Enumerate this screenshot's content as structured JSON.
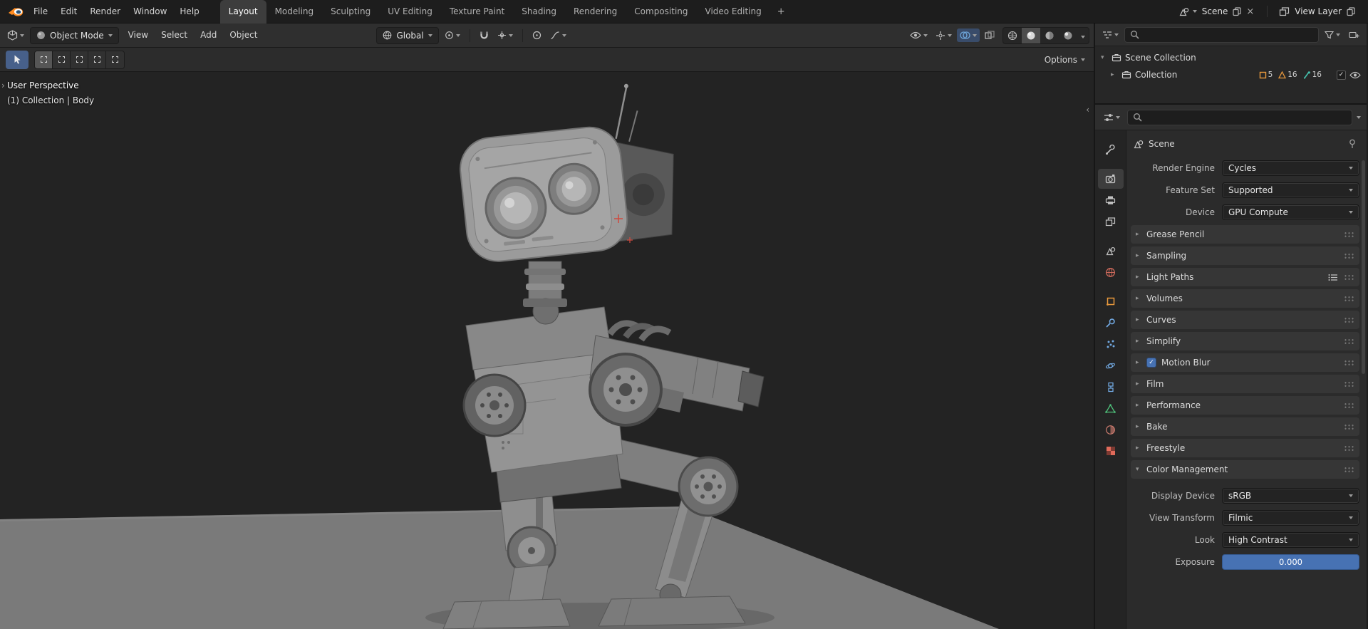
{
  "topbar": {
    "menus": [
      "File",
      "Edit",
      "Render",
      "Window",
      "Help"
    ],
    "workspaces": [
      "Layout",
      "Modeling",
      "Sculpting",
      "UV Editing",
      "Texture Paint",
      "Shading",
      "Rendering",
      "Compositing",
      "Video Editing"
    ],
    "active_workspace": "Layout",
    "new_workspace_label": "+",
    "scene_selector": {
      "label": "Scene"
    },
    "view_layer_selector": {
      "label": "View Layer"
    }
  },
  "viewport": {
    "header": {
      "mode": "Object Mode",
      "menus": [
        "View",
        "Select",
        "Add",
        "Object"
      ],
      "orientation": "Global"
    },
    "tool_settings": {
      "options_label": "Options"
    },
    "overlay": {
      "line1": "User Perspective",
      "line2": "(1) Collection | Body"
    }
  },
  "outliner": {
    "scene_collection": {
      "label": "Scene Collection"
    },
    "collection": {
      "label": "Collection",
      "badges": [
        {
          "icon": "object-icon",
          "count": "5"
        },
        {
          "icon": "mesh-icon",
          "count": "16"
        },
        {
          "icon": "armature-icon",
          "count": "16"
        }
      ]
    }
  },
  "properties": {
    "context_label": "Scene",
    "fields": [
      {
        "label": "Render Engine",
        "value": "Cycles"
      },
      {
        "label": "Feature Set",
        "value": "Supported"
      },
      {
        "label": "Device",
        "value": "GPU Compute"
      }
    ],
    "panels": [
      {
        "label": "Grease Pencil"
      },
      {
        "label": "Sampling"
      },
      {
        "label": "Light Paths",
        "has_presets": true
      },
      {
        "label": "Volumes"
      },
      {
        "label": "Curves"
      },
      {
        "label": "Simplify"
      },
      {
        "label": "Motion Blur",
        "checkbox": true,
        "checked": true
      },
      {
        "label": "Film"
      },
      {
        "label": "Performance"
      },
      {
        "label": "Bake"
      },
      {
        "label": "Freestyle"
      },
      {
        "label": "Color Management",
        "expanded": true
      }
    ],
    "color_management": {
      "fields": [
        {
          "label": "Display Device",
          "value": "sRGB"
        },
        {
          "label": "View Transform",
          "value": "Filmic"
        },
        {
          "label": "Look",
          "value": "High Contrast"
        }
      ],
      "exposure": {
        "label": "Exposure",
        "value": "0.000"
      }
    },
    "tabs": [
      "tool",
      "render",
      "output",
      "view-layer",
      "scene",
      "world",
      "object",
      "modifiers",
      "particles",
      "physics",
      "constraints",
      "object-data",
      "material",
      "texture"
    ],
    "active_tab": "render"
  },
  "colors": {
    "accent_blue": "#4772b3",
    "accent_orange": "#e8983c",
    "viewport_bg": "#232323",
    "floor": "#7a7a7a"
  }
}
